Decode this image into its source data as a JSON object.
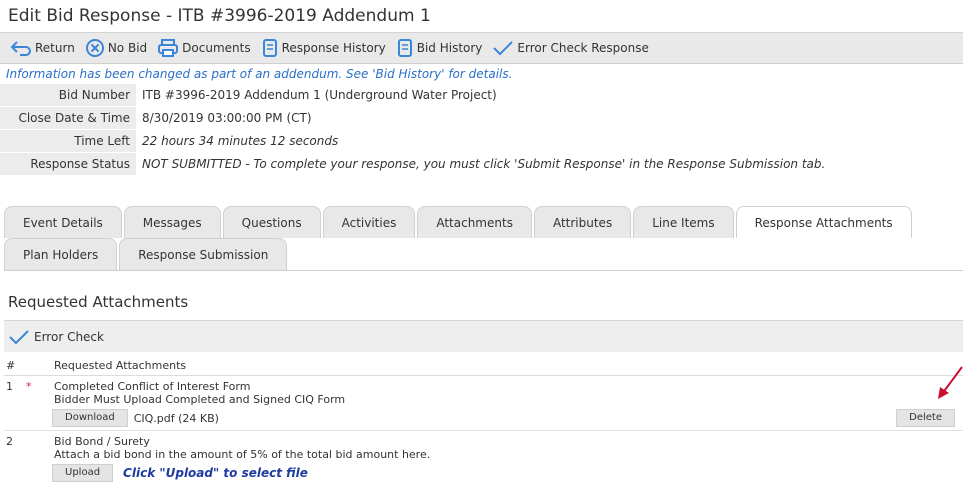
{
  "window": {
    "title": "Edit Bid Response - ITB #3996-2019 Addendum 1"
  },
  "toolbar": {
    "items": [
      {
        "label": "Return",
        "icon": "return-arrow-icon"
      },
      {
        "label": "No Bid",
        "icon": "no-bid-circle-x-icon"
      },
      {
        "label": "Documents",
        "icon": "printer-documents-icon"
      },
      {
        "label": "Response History",
        "icon": "history-document-icon"
      },
      {
        "label": "Bid History",
        "icon": "history-document-icon"
      },
      {
        "label": "Error Check Response",
        "icon": "checkmark-icon"
      }
    ]
  },
  "notice": "Information has been changed as part of an addendum. See 'Bid History' for details.",
  "details": {
    "bid_number_label": "Bid Number",
    "bid_number": "ITB #3996-2019 Addendum 1 (Underground Water Project)",
    "close_label": "Close Date & Time",
    "close_value": "8/30/2019 03:00:00 PM (CT)",
    "time_left_label": "Time Left",
    "time_left_value": "22 hours 34 minutes 12 seconds",
    "status_label": "Response Status",
    "status_value": "NOT SUBMITTED - To complete your response, you must click 'Submit Response' in the Response Submission tab."
  },
  "tabs": {
    "row1": [
      "Event Details",
      "Messages",
      "Questions",
      "Activities",
      "Attachments",
      "Attributes",
      "Line Items",
      "Response Attachments"
    ],
    "row2": [
      "Plan Holders",
      "Response Submission"
    ],
    "active": "Response Attachments"
  },
  "section": {
    "title": "Requested Attachments",
    "error_check_label": "Error Check",
    "col_num": "#",
    "col_name": "Requested Attachments"
  },
  "attachments": [
    {
      "num": "1",
      "required": "*",
      "name": "Completed Conflict of Interest Form",
      "desc": "Bidder Must Upload Completed and Signed CIQ Form",
      "action_label": "Download",
      "file": "CIQ.pdf (24 KB)",
      "delete_label": "Delete"
    },
    {
      "num": "2",
      "required": "",
      "name": "Bid Bond / Surety",
      "desc": "Attach a bid bond in the amount of 5% of the total bid amount here.",
      "action_label": "Upload",
      "file": "Click \"Upload\" to select file"
    }
  ],
  "colors": {
    "accent_blue": "#2a6fc9",
    "alert_red": "#d6223a",
    "arrow": "#c8102e"
  }
}
